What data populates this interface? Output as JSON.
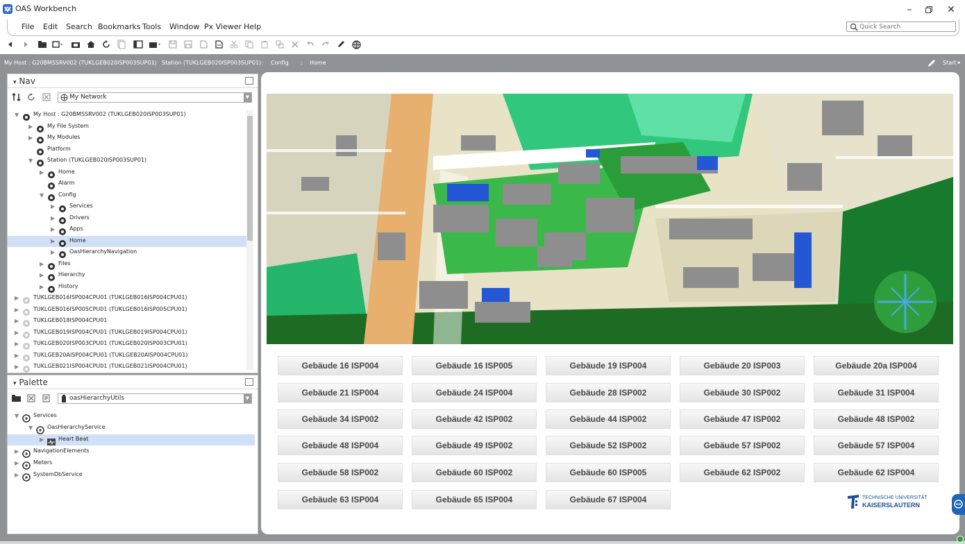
{
  "app": {
    "title": "OAS Workbench"
  },
  "menu": [
    "File",
    "Edit",
    "Search",
    "Bookmarks",
    "Tools",
    "Window",
    "Px Viewer",
    "Help"
  ],
  "quick_search": {
    "placeholder": "Quick Search"
  },
  "path": {
    "crumbs": [
      "My Host : G20BMSSRV002 (TUKLGEB020ISP003SUP01)",
      "Station (TUKLGEB020ISP003SUP01)",
      "Config",
      "Home"
    ],
    "start_label": "Start"
  },
  "nav": {
    "title": "Nav",
    "network": "My Network",
    "tree": [
      {
        "label": "My Host : G20BMSSRV002 (TUKLGEB020ISP003SUP01)",
        "expanded": true,
        "icon": "host-icon"
      },
      {
        "label": "My File System",
        "icon": "file-system-icon"
      },
      {
        "label": "My Modules",
        "icon": "modules-icon"
      },
      {
        "label": "Platform",
        "icon": "platform-icon"
      },
      {
        "label": "Station (TUKLGEB020ISP003SUP01)",
        "expanded": true,
        "icon": "station-icon"
      },
      {
        "label": "Home",
        "icon": "home-icon"
      },
      {
        "label": "Alarm",
        "icon": "alarm-bell-icon"
      },
      {
        "label": "Config",
        "expanded": true,
        "icon": "config-icon"
      },
      {
        "label": "Services",
        "icon": "services-icon"
      },
      {
        "label": "Drivers",
        "icon": "drivers-icon"
      },
      {
        "label": "Apps",
        "icon": "apps-icon"
      },
      {
        "label": "Home",
        "selected": true,
        "icon": "home-node-icon"
      },
      {
        "label": "OasHierarchyNavigation",
        "icon": "hierarchy-navigation-icon"
      },
      {
        "label": "Files",
        "icon": "files-icon"
      },
      {
        "label": "Hierarchy",
        "icon": "hierarchy-icon"
      },
      {
        "label": "History",
        "icon": "history-icon"
      },
      {
        "label": "TUKLGEB016ISP004CPU01 (TUKLGEB016ISP004CPU01)",
        "icon": "station-disconnected-icon"
      },
      {
        "label": "TUKLGEB016ISP005CPU01 (TUKLGEB016ISP005CPU01)",
        "icon": "station-disconnected-icon"
      },
      {
        "label": "TUKLGEB018ISP004CPU01",
        "icon": "station-disconnected-icon"
      },
      {
        "label": "TUKLGEB019ISP004CPU01 (TUKLGEB019ISP004CPU01)",
        "icon": "station-disconnected-icon"
      },
      {
        "label": "TUKLGEB020ISP003CPU01 (TUKLGEB020ISP003CPU01)",
        "icon": "station-disconnected-icon"
      },
      {
        "label": "TUKLGEB20AISP004CPU01 (TUKLGEB20AISP004CPU01)",
        "icon": "station-disconnected-icon"
      },
      {
        "label": "TUKLGEB021ISP004CPU01 (TUKLGEB021ISP004CPU01)",
        "icon": "station-disconnected-icon"
      }
    ]
  },
  "palette": {
    "title": "Palette",
    "module": "oasHierarchyUtils",
    "tree": [
      {
        "label": "Services",
        "expanded": true,
        "icon": "folder-node-icon"
      },
      {
        "label": "OasHierarchyService",
        "expanded": true,
        "icon": "service-icon"
      },
      {
        "label": "Heart Beat",
        "selected": true,
        "icon": "heartbeat-icon"
      },
      {
        "label": "NavigationElements",
        "icon": "folder-node-icon"
      },
      {
        "label": "Meters",
        "icon": "folder-node-icon"
      },
      {
        "label": "SystemDbService",
        "icon": "folder-node-icon"
      }
    ]
  },
  "buildings": [
    "Gebäude 16 ISP004",
    "Gebäude 16 ISP005",
    "Gebäude 19 ISP004",
    "Gebäude 20 ISP003",
    "Gebäude 20a ISP004",
    "Gebäude 21 ISP004",
    "Gebäude 24 ISP004",
    "Gebäude 28 ISP002",
    "Gebäude 30 ISP002",
    "Gebäude 31 ISP004",
    "Gebäude 34 ISP002",
    "Gebäude 42 ISP002",
    "Gebäude 44 ISP002",
    "Gebäude 47 ISP002",
    "Gebäude 48 ISP002",
    "Gebäude 48 ISP004",
    "Gebäude 49 ISP002",
    "Gebäude 52 ISP002",
    "Gebäude 57 ISP002",
    "Gebäude 57 ISP004",
    "Gebäude 58 ISP002",
    "Gebäude 60 ISP002",
    "Gebäude 60 ISP005",
    "Gebäude 62 ISP002",
    "Gebäude 62 ISP004",
    "Gebäude 63 ISP004",
    "Gebäude 65 ISP004",
    "Gebäude 67 ISP004"
  ],
  "logo": {
    "line1": "TECHNISCHE UNIVERSITÄT",
    "line2": "KAISERSLAUTERN"
  },
  "colors": {
    "path_bar": "#8f9396",
    "selection": "#cfe0f7",
    "tu_blue": "#1f4e92",
    "roof_blue": "#2457d6",
    "grass": "#2f9e3a"
  }
}
